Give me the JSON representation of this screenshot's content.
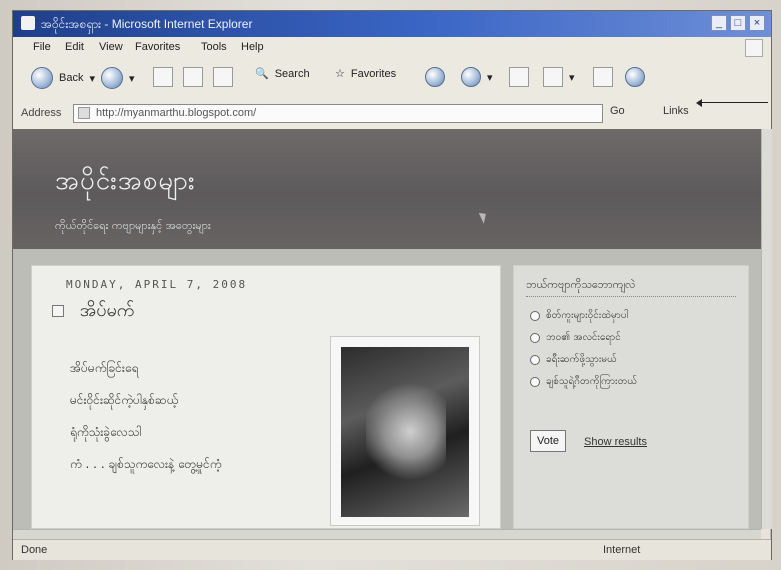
{
  "window": {
    "title": "အဝိုင်းအစရှား - Microsoft Internet Explorer",
    "menu": [
      "File",
      "Edit",
      "View",
      "Favorites",
      "Tools",
      "Help"
    ],
    "toolbar": {
      "back": "Back",
      "search": "Search",
      "favorites": "Favorites"
    },
    "address": {
      "label": "Address",
      "url": "http://myanmarthu.blogspot.com/",
      "go": "Go",
      "links": "Links"
    },
    "status": {
      "left": "Done",
      "right": "Internet"
    }
  },
  "blog": {
    "title": "အပိုင်းအစများ",
    "description": "ကိုယ်တိုင်ရေး ကဗျာများနှင့် အတွေးများ"
  },
  "post": {
    "date": "MONDAY, APRIL 7, 2008",
    "title": "အိပ်မက်",
    "lines": [
      "အိပ်မက်ခြင်းရေ",
      "မင်းဝိုင်းဆိုင်ကဲ့ပါနှစ်ဆယ့်",
      "ရုံကိုသုံးခွဲလေသါ",
      "ကံ . . . ချစ်သူကလေးနဲ့ တွေ့မှုင်ကံ့"
    ]
  },
  "poll": {
    "heading": "ဘယ်ကဗျာကိုသဘောကျလဲ",
    "options": [
      "စိတ်ကူးများဝိုင်းထဲမှာပါ",
      "ဘဝ၏ အလင်းရောင်",
      "ခရီးဆက်ဖို့သွားမယ်",
      "ချစ်သူရဲ့ဂီတကိုကြားတယ်"
    ],
    "vote_label": "Vote",
    "results_label": "Show results"
  }
}
